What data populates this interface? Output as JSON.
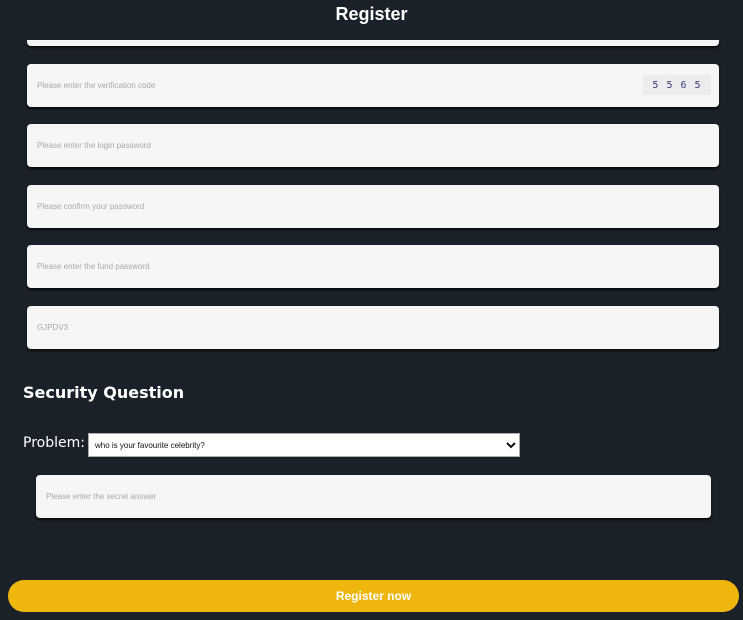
{
  "header": {
    "title": "Register"
  },
  "fields": {
    "verification": {
      "placeholder": "Please enter the verification code",
      "captcha_text": "5 5 6 5"
    },
    "login_password": {
      "placeholder": "Please enter the login password"
    },
    "confirm_password": {
      "placeholder": "Please confirm your password"
    },
    "fund_password": {
      "placeholder": "Please enter the fund password"
    },
    "invite_code": {
      "placeholder": "GJPDV3"
    }
  },
  "security": {
    "heading": "Security Question",
    "problem_label": "Problem:",
    "selected_question": "who is your favourite celebrity?",
    "answer_placeholder": "Please enter the secret answer"
  },
  "actions": {
    "register_label": "Register now"
  },
  "colors": {
    "background": "#1a2128",
    "accent": "#efb70e",
    "field": "#f6f6f6"
  }
}
